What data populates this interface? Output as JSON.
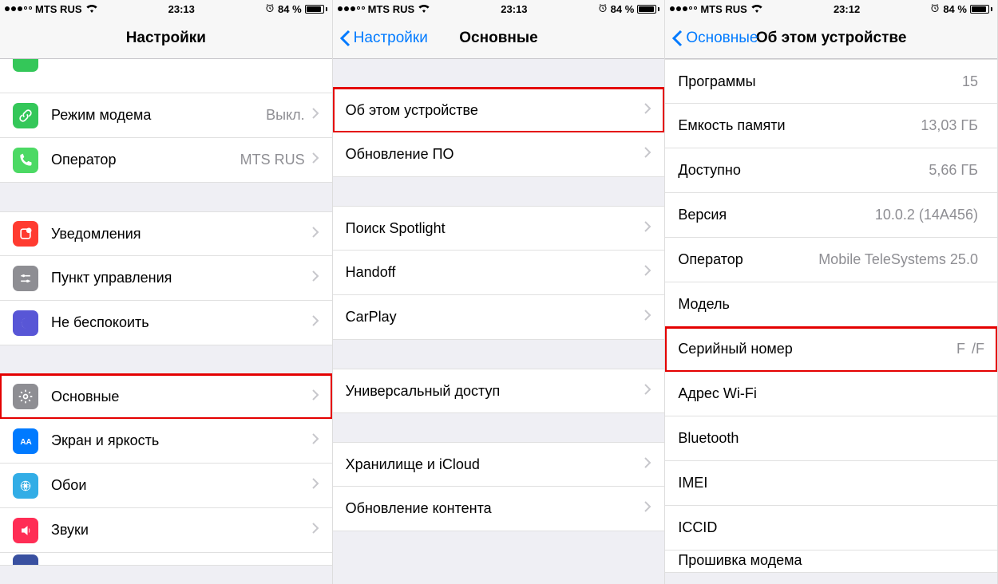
{
  "status": {
    "carrier": "MTS RUS",
    "time1": "23:13",
    "time2": "23:13",
    "time3": "23:12",
    "battery": "84 %"
  },
  "screen1": {
    "title": "Настройки",
    "rows": {
      "hotspot": {
        "label": "Режим модема",
        "value": "Выкл."
      },
      "carrier": {
        "label": "Оператор",
        "value": "MTS RUS"
      },
      "notifications": {
        "label": "Уведомления"
      },
      "control_center": {
        "label": "Пункт управления"
      },
      "dnd": {
        "label": "Не беспокоить"
      },
      "general": {
        "label": "Основные"
      },
      "display": {
        "label": "Экран и яркость"
      },
      "wallpaper": {
        "label": "Обои"
      },
      "sounds": {
        "label": "Звуки"
      }
    }
  },
  "screen2": {
    "back": "Настройки",
    "title": "Основные",
    "rows": {
      "about": {
        "label": "Об этом устройстве"
      },
      "software_update": {
        "label": "Обновление ПО"
      },
      "spotlight": {
        "label": "Поиск Spotlight"
      },
      "handoff": {
        "label": "Handoff"
      },
      "carplay": {
        "label": "CarPlay"
      },
      "accessibility": {
        "label": "Универсальный доступ"
      },
      "storage": {
        "label": "Хранилище и iCloud"
      },
      "background_refresh": {
        "label": "Обновление контента"
      }
    }
  },
  "screen3": {
    "back": "Основные",
    "title": "Об этом устройстве",
    "rows": {
      "apps": {
        "label": "Программы",
        "value": "15"
      },
      "capacity": {
        "label": "Емкость памяти",
        "value": "13,03 ГБ"
      },
      "available": {
        "label": "Доступно",
        "value": "5,66 ГБ"
      },
      "version": {
        "label": "Версия",
        "value": "10.0.2 (14A456)"
      },
      "carrier": {
        "label": "Оператор",
        "value": "Mobile TeleSystems 25.0"
      },
      "model": {
        "label": "Модель",
        "value": ""
      },
      "serial": {
        "label": "Серийный номер",
        "value": "F",
        "value2": "/F"
      },
      "wifi": {
        "label": "Адрес Wi-Fi",
        "value": ""
      },
      "bluetooth": {
        "label": "Bluetooth",
        "value": ""
      },
      "imei": {
        "label": "IMEI",
        "value": ""
      },
      "iccid": {
        "label": "ICCID",
        "value": ""
      },
      "modem": {
        "label": "Прошивка модема",
        "value": ""
      }
    }
  }
}
